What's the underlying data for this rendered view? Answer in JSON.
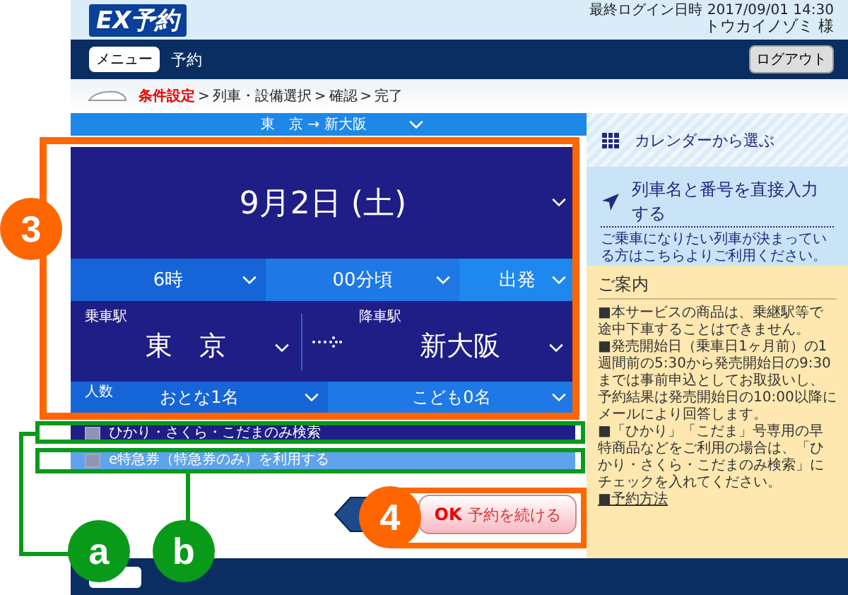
{
  "header": {
    "logo": "EX予約",
    "last_login": "最終ログイン日時 2017/09/01 14:30",
    "user": "トウカイノゾミ 様"
  },
  "nav": {
    "menu_button": "メニュー",
    "title": "予約",
    "logout_button": "ログアウト"
  },
  "breadcrumb": {
    "separator": ">",
    "steps": [
      {
        "label": "条件設定",
        "selected": true
      },
      {
        "label": "列車・設備選択",
        "selected": false
      },
      {
        "label": "確認",
        "selected": false
      },
      {
        "label": "完了",
        "selected": false
      }
    ]
  },
  "route_bar": {
    "text": "東　京 → 新大阪"
  },
  "form": {
    "date": "9月2日 (土)",
    "hour": "6時",
    "minute": "00分頃",
    "mode": "出発",
    "departure_label": "乗車駅",
    "departure": "東　京",
    "arrival_label": "降車駅",
    "arrival": "新大阪",
    "people_label": "人数",
    "adults": "おとな1名",
    "children": "こども0名"
  },
  "options": [
    {
      "label": "ひかり・さくら・こだまのみ検索",
      "checked": false
    },
    {
      "label": "e特急券（特急券のみ）を利用する",
      "checked": false
    }
  ],
  "continue_button": {
    "prefix": "OK",
    "label": "予約を続ける"
  },
  "sidebar": {
    "calendar": "カレンダーから選ぶ",
    "train_title": "列車名と番号を直接入力する",
    "train_desc": "ご乗車になりたい列車が決まっている方はこちらよりご利用ください。",
    "info_title": "ご案内",
    "info_items": [
      "■本サービスの商品は、乗継駅等で途中下車することはできません。",
      "■発売開始日（乗車日1ヶ月前）の1週間前の5:30から発売開始日の9:30までは事前申込としてお取扱いし、予約結果は発売開始日の10:00以降にメールにより回答します。",
      "■「ひかり」「こだま」号専用の早特商品などをご利用の場合は、「ひかり・さくら・こだまのみ検索」にチェックを入れてください。"
    ],
    "info_link": "■予約方法"
  },
  "annotations": [
    {
      "label": "3",
      "color": "#ff6600"
    },
    {
      "label": "4",
      "color": "#ff6600"
    },
    {
      "label": "a",
      "color": "#0a9a1a"
    },
    {
      "label": "b",
      "color": "#0a9a1a"
    }
  ]
}
